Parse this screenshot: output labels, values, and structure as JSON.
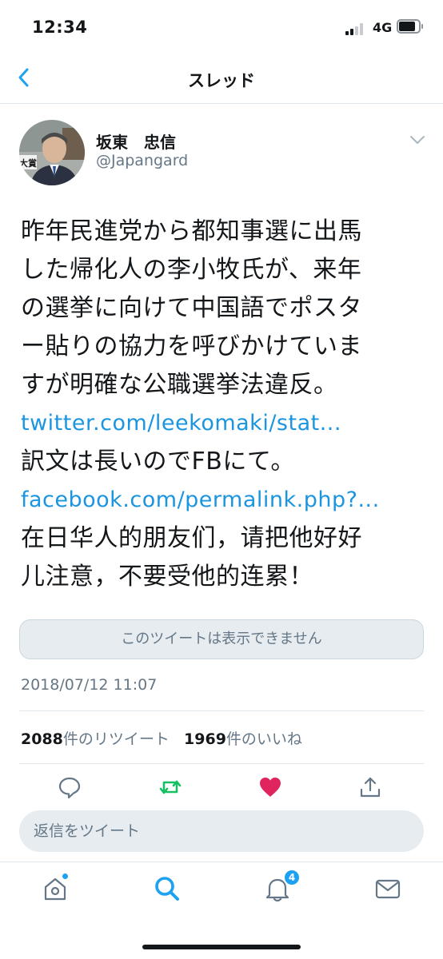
{
  "status_bar": {
    "time": "12:34",
    "network": "4G"
  },
  "nav": {
    "title": "スレッド"
  },
  "tweet": {
    "display_name": "坂東　忠信",
    "handle": "@Japangard",
    "avatar_badge": "大賞",
    "lines": [
      {
        "text": "昨年民進党から都知事選に出馬",
        "link": false
      },
      {
        "text": "した帰化人の李小牧氏が、来年",
        "link": false
      },
      {
        "text": "の選挙に向けて中国語でポスタ",
        "link": false
      },
      {
        "text": "ー貼りの協力を呼びかけていま",
        "link": false
      },
      {
        "text": "すが明確な公職選挙法違反。",
        "link": false
      },
      {
        "text": "twitter.com/leekomaki/stat...",
        "link": true
      },
      {
        "text": "訳文は長いのでFBにて。",
        "link": false
      },
      {
        "text": "facebook.com/permalink.php?...",
        "link": true
      },
      {
        "text": "在日华人的朋友们，请把他好好",
        "link": false
      },
      {
        "text": "儿注意，不要受他的连累！",
        "link": false
      }
    ],
    "unavailable_notice": "このツイートは表示できません",
    "timestamp": "2018/07/12 11:07",
    "retweet_count": "2088",
    "retweet_label": "件のリツイート",
    "like_count": "1969",
    "like_label": "件のいいね"
  },
  "actions": [
    {
      "icon": "reply-icon"
    },
    {
      "icon": "retweet-icon",
      "color": "#17bf63"
    },
    {
      "icon": "like-icon",
      "color": "#e0245e"
    },
    {
      "icon": "share-icon"
    }
  ],
  "reply_box": {
    "placeholder": "返信をツイート"
  },
  "tab_bar": {
    "items": [
      {
        "icon": "home-icon"
      },
      {
        "icon": "search-icon",
        "active": true
      },
      {
        "icon": "notifications-icon",
        "badge": "4"
      },
      {
        "icon": "messages-icon"
      }
    ]
  },
  "colors": {
    "accent": "#1da1f2",
    "link": "#1b95e0",
    "secondary_text": "#657786",
    "retweet": "#17bf63",
    "like": "#e0245e"
  }
}
